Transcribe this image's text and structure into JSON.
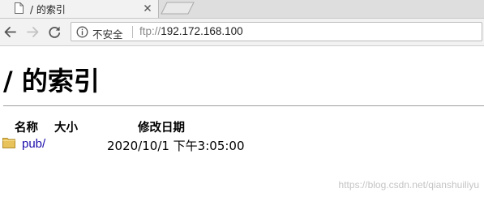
{
  "tab": {
    "title": "/ 的索引",
    "icon": "document-icon",
    "close_icon": "close-icon"
  },
  "toolbar": {
    "back_icon": "back-arrow-icon",
    "forward_icon": "forward-arrow-icon",
    "reload_icon": "reload-icon",
    "security_icon": "info-icon",
    "security_label": "不安全",
    "url_scheme": "ftp://",
    "url_host": "192.172.168.100"
  },
  "page": {
    "title": "/ 的索引",
    "columns": {
      "name": "名称",
      "size": "大小",
      "modified": "修改日期"
    },
    "entries": [
      {
        "icon": "folder-icon",
        "name": "pub/",
        "size": "",
        "modified": "2020/10/1 下午3:05:00"
      }
    ]
  },
  "watermark": "https://blog.csdn.net/qianshuiliyu",
  "colors": {
    "link": "#1a0dab",
    "folder": "#e8c25a",
    "tabstrip": "#dedede",
    "toolbar": "#f2f2f2"
  }
}
